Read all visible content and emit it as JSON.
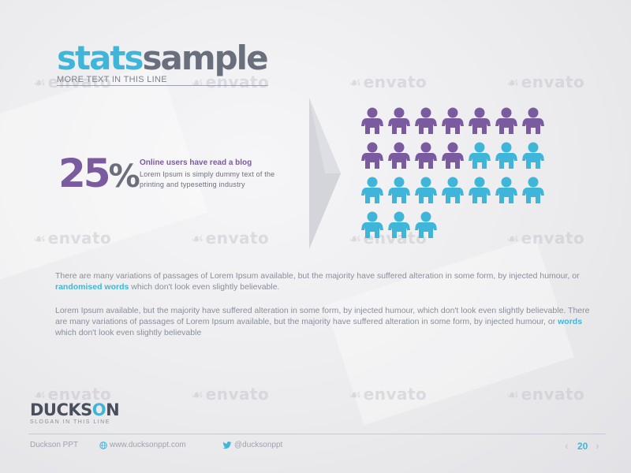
{
  "title": {
    "part1": "stats",
    "part2": "sample",
    "subtitle": "MORE TEXT IN THIS LINE"
  },
  "stat": {
    "value": "25",
    "unit": "%",
    "headline": "Online users have read a blog",
    "description": "Lorem  Ipsum is simply dummy text  of the printing and typesetting  industry"
  },
  "pictogram": {
    "total": 24,
    "highlighted": 11,
    "per_row": 7,
    "highlight_color": "#7b5ba0",
    "base_color": "#3fb6d9"
  },
  "paragraphs": {
    "p1_before": "There are many variations of passages of Lorem Ipsum available, but the majority have suffered alteration in some form, by injected humour, or ",
    "p1_highlight": "randomised words",
    "p1_after": " which don't look even slightly believable.",
    "p2_before": "Lorem Ipsum available, but the majority have suffered alteration in some form, by injected humour, which don't look even slightly believable. There are many variations of passages of Lorem Ipsum available, but the majority have suffered alteration in some form, by injected humour, or ",
    "p2_highlight": "words",
    "p2_after": " which don't look even slightly believable"
  },
  "brand": {
    "logo_a": "DUCKS",
    "logo_b": "O",
    "logo_c": "N",
    "slogan": "SLOGAN IN THIS LINE"
  },
  "footer": {
    "company": "Duckson PPT",
    "website": "www.ducksonppt.com",
    "twitter": "@ducksonppt",
    "page_number": "20",
    "prev_glyph": "‹",
    "next_glyph": "›"
  },
  "watermark": {
    "text": "envato"
  },
  "colors": {
    "accent_blue": "#3fb6d9",
    "accent_purple": "#7b5ba0",
    "text_gray": "#6b6f7c"
  }
}
